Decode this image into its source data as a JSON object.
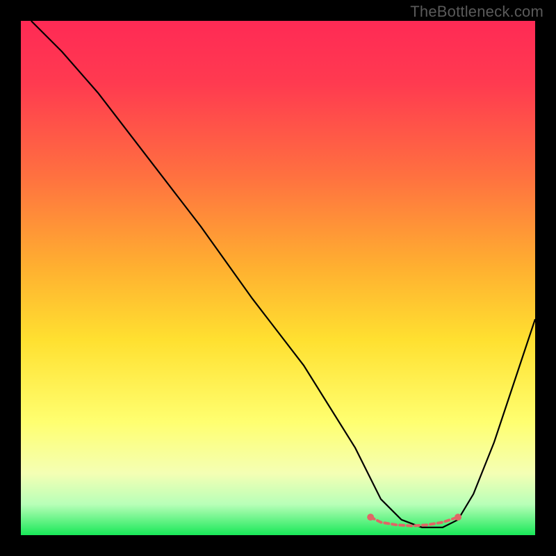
{
  "watermark": "TheBottleneck.com",
  "chart_data": {
    "type": "line",
    "title": "",
    "xlabel": "",
    "ylabel": "",
    "xlim": [
      0,
      100
    ],
    "ylim": [
      0,
      100
    ],
    "grid": false,
    "series": [
      {
        "name": "curve",
        "color": "#000000",
        "x": [
          2,
          8,
          15,
          25,
          35,
          45,
          55,
          60,
          65,
          68,
          70,
          74,
          78,
          82,
          85,
          88,
          92,
          96,
          100
        ],
        "y": [
          100,
          94,
          86,
          73,
          60,
          46,
          33,
          25,
          17,
          11,
          7,
          3,
          1.5,
          1.5,
          3,
          8,
          18,
          30,
          42
        ]
      },
      {
        "name": "optimal-range",
        "color": "#e06666",
        "style": "dashed-markers",
        "x": [
          68,
          70,
          73,
          76,
          79,
          82,
          85
        ],
        "y": [
          3.5,
          2.5,
          2,
          1.8,
          2,
          2.5,
          3.5
        ]
      }
    ],
    "background_gradient": {
      "top": "#ff2a4d",
      "mid_upper": "#ff8040",
      "mid": "#ffd040",
      "mid_lower": "#ffff60",
      "lower": "#e8ffb0",
      "bottom": "#20e060"
    }
  }
}
